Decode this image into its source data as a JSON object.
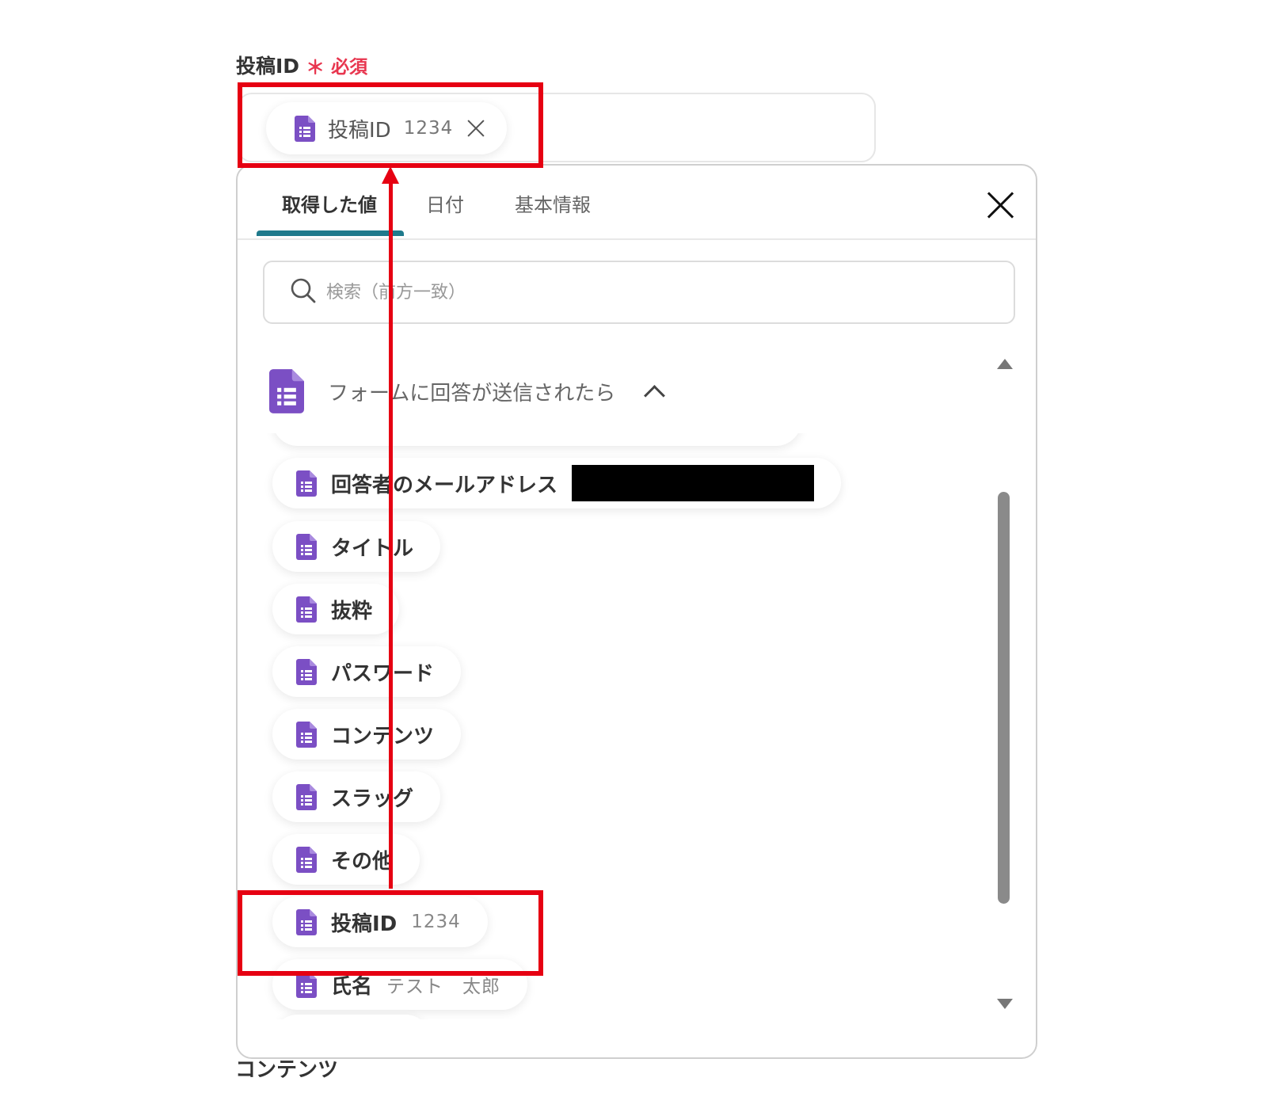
{
  "field": {
    "label": "投稿ID",
    "required_mark": "＊",
    "required_text": "必須",
    "chip": {
      "label": "投稿ID",
      "value": "1234"
    }
  },
  "popup": {
    "tabs": [
      {
        "label": "取得した値",
        "active": true
      },
      {
        "label": "日付",
        "active": false
      },
      {
        "label": "基本情報",
        "active": false
      }
    ],
    "search_placeholder": "検索（前方一致）",
    "group_title": "フォームに回答が送信されたら",
    "items": [
      {
        "label": "回答者のメールアドレス",
        "value": "",
        "redacted": true
      },
      {
        "label": "タイトル",
        "value": ""
      },
      {
        "label": "抜粋",
        "value": ""
      },
      {
        "label": "パスワード",
        "value": ""
      },
      {
        "label": "コンテンツ",
        "value": ""
      },
      {
        "label": "スラッグ",
        "value": ""
      },
      {
        "label": "その他",
        "value": ""
      },
      {
        "label": "投稿ID",
        "value": "1234"
      },
      {
        "label": "氏名",
        "value": "テスト　太郎"
      }
    ]
  },
  "next_field_label": "コンテンツ",
  "colors": {
    "accent_tab": "#1f7a8c",
    "required": "#e8364f",
    "doc_icon": "#7b4fc4",
    "annotation": "#e60012"
  },
  "icons": [
    "google-forms-doc-icon",
    "close-icon",
    "search-icon",
    "chevron-up-icon"
  ]
}
